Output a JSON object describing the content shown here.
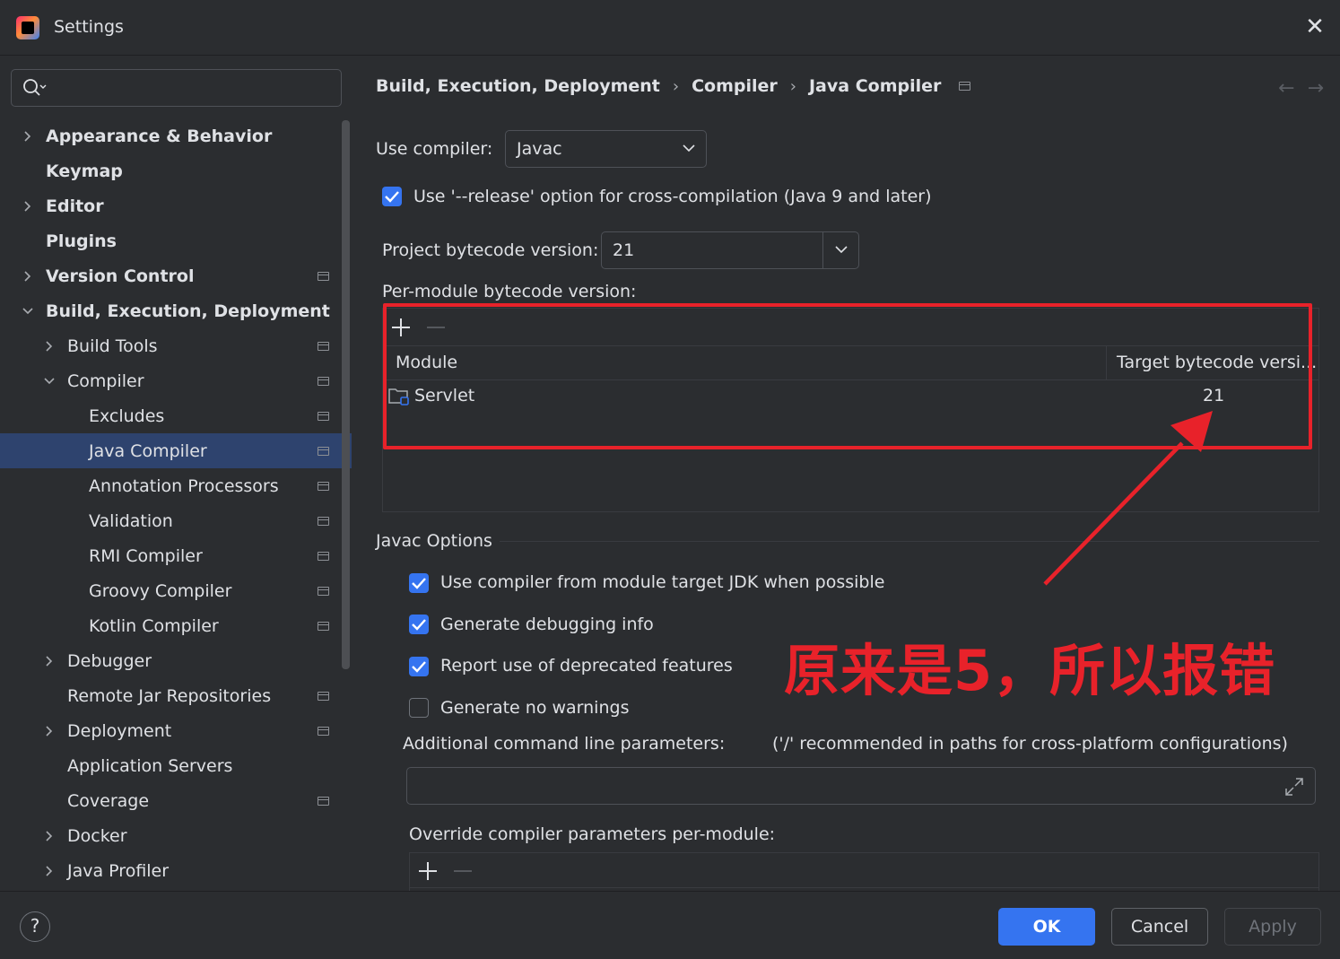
{
  "window": {
    "title": "Settings"
  },
  "search": {
    "placeholder": ""
  },
  "sidebar": {
    "items": [
      {
        "label": "Appearance & Behavior"
      },
      {
        "label": "Keymap"
      },
      {
        "label": "Editor"
      },
      {
        "label": "Plugins"
      },
      {
        "label": "Version Control"
      },
      {
        "label": "Build, Execution, Deployment"
      },
      {
        "label": "Build Tools"
      },
      {
        "label": "Compiler"
      },
      {
        "label": "Excludes"
      },
      {
        "label": "Java Compiler"
      },
      {
        "label": "Annotation Processors"
      },
      {
        "label": "Validation"
      },
      {
        "label": "RMI Compiler"
      },
      {
        "label": "Groovy Compiler"
      },
      {
        "label": "Kotlin Compiler"
      },
      {
        "label": "Debugger"
      },
      {
        "label": "Remote Jar Repositories"
      },
      {
        "label": "Deployment"
      },
      {
        "label": "Application Servers"
      },
      {
        "label": "Coverage"
      },
      {
        "label": "Docker"
      },
      {
        "label": "Java Profiler"
      }
    ]
  },
  "breadcrumb": {
    "part1": "Build, Execution, Deployment",
    "part2": "Compiler",
    "part3": "Java Compiler",
    "separator": "›"
  },
  "compiler": {
    "use_label": "Use compiler:",
    "use_value": "Javac",
    "release_option": "Use '--release' option for cross-compilation (Java 9 and later)",
    "project_bytecode_label": "Project bytecode version:",
    "project_bytecode_value": "21",
    "per_module_label": "Per-module bytecode version:"
  },
  "module_table": {
    "col_module": "Module",
    "col_target": "Target bytecode versi...",
    "rows": [
      {
        "module": "Servlet",
        "target": "21"
      }
    ]
  },
  "javac": {
    "section_title": "Javac Options",
    "opt1": "Use compiler from module target JDK when possible",
    "opt2": "Generate debugging info",
    "opt3": "Report use of deprecated features",
    "opt4": "Generate no warnings",
    "additional_label": "Additional command line parameters:",
    "additional_hint": "('/' recommended in paths for cross-platform configurations)",
    "override_label": "Override compiler parameters per-module:"
  },
  "annotation": {
    "text": "原来是5，所以报错"
  },
  "footer": {
    "help": "?",
    "ok": "OK",
    "cancel": "Cancel",
    "apply": "Apply"
  },
  "colors": {
    "accent": "#3574f0",
    "annotation": "#e8222a",
    "selection": "#2e436e"
  }
}
